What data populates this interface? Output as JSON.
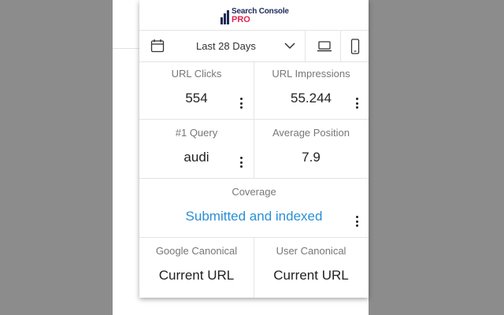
{
  "brand": {
    "title": "Search Console",
    "badge": "PRO"
  },
  "toolbar": {
    "date_range": "Last 28 Days",
    "icons": [
      "calendar-icon",
      "chevron-down-icon",
      "laptop-icon",
      "phone-icon"
    ]
  },
  "metrics": {
    "url_clicks": {
      "label": "URL Clicks",
      "value": "554"
    },
    "url_impressions": {
      "label": "URL Impressions",
      "value": "55.244"
    },
    "top_query": {
      "label": "#1 Query",
      "value": "audi"
    },
    "average_position": {
      "label": "Average Position",
      "value": "7.9"
    },
    "coverage": {
      "label": "Coverage",
      "value": "Submitted and indexed"
    },
    "google_canonical": {
      "label": "Google Canonical",
      "value": "Current URL"
    },
    "user_canonical": {
      "label": "User Canonical",
      "value": "Current URL"
    }
  },
  "colors": {
    "accent": "#2a8fd6",
    "brand_navy": "#1f2a56",
    "brand_pro": "#e0234b"
  }
}
